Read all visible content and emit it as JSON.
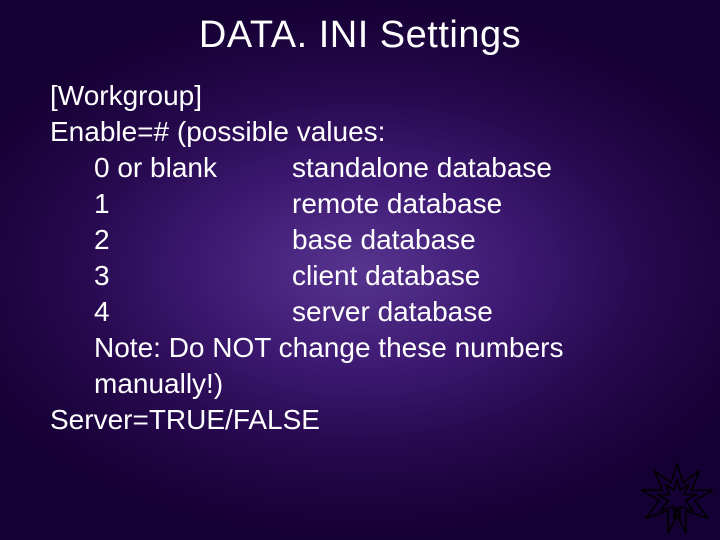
{
  "title": "DATA. INI Settings",
  "body": {
    "section": "[Workgroup]",
    "enable_line": "Enable=# (possible values:",
    "rows": [
      {
        "key": "0 or blank",
        "val": "standalone database"
      },
      {
        "key": "1",
        "val": "remote database"
      },
      {
        "key": "2",
        "val": "base database"
      },
      {
        "key": "3",
        "val": "client database"
      },
      {
        "key": "4",
        "val": "server database"
      }
    ],
    "note_l1": "Note: Do NOT change these numbers",
    "note_l2": "manually!)",
    "server_line": "Server=TRUE/FALSE"
  },
  "icon": "star-icon"
}
